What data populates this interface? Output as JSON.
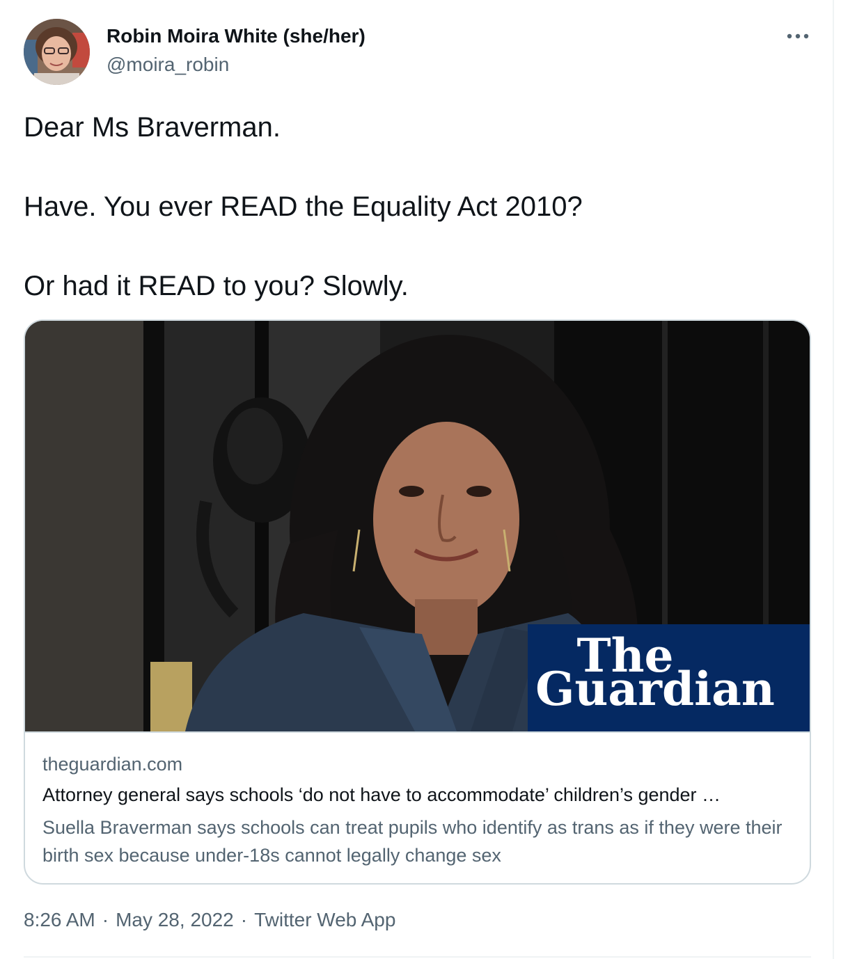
{
  "author": {
    "name": "Robin Moira White (she/her)",
    "handle": "@moira_robin",
    "avatar_icon": "avatar-photo"
  },
  "menu": {
    "more_icon": "more-horizontal-icon",
    "more_glyph": "···"
  },
  "tweet": {
    "paragraphs": [
      "Dear Ms Braverman.",
      "Have. You ever READ the Equality Act 2010?",
      "Or had it READ to you? Slowly."
    ]
  },
  "card": {
    "image_logo_line1": "The",
    "image_logo_line2": "Guardian",
    "domain": "theguardian.com",
    "title": "Attorney general says schools ‘do not have to accommodate’ children’s gender …",
    "description": "Suella Braverman says schools can treat pupils who identify as trans as if they were their birth sex because under-18s cannot legally change sex"
  },
  "meta": {
    "time": "8:26 AM",
    "separator": "·",
    "date": "May 28, 2022",
    "source": "Twitter Web App"
  },
  "colors": {
    "text_primary": "#0f1419",
    "text_secondary": "#536471",
    "border": "#cfd9de",
    "guardian_blue": "#052962"
  }
}
